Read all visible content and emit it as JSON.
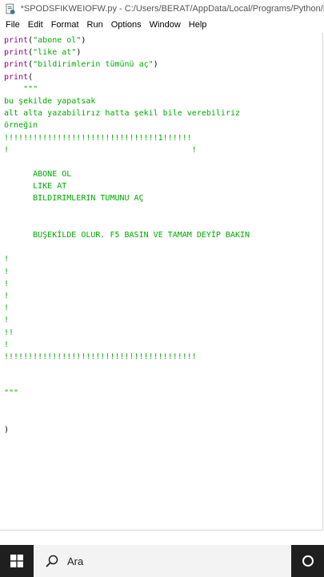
{
  "window": {
    "title": "*SPODSFIKWEIOFW.py - C:/Users/BERAT/AppData/Local/Programs/Python/Py"
  },
  "menu": {
    "items": [
      "File",
      "Edit",
      "Format",
      "Run",
      "Options",
      "Window",
      "Help"
    ]
  },
  "editor": {
    "lines": [
      [
        {
          "t": "print",
          "c": "kw"
        },
        {
          "t": "(",
          "c": ""
        },
        {
          "t": "\"abone ol\"",
          "c": "str"
        },
        {
          "t": ")",
          "c": ""
        }
      ],
      [
        {
          "t": "print",
          "c": "kw"
        },
        {
          "t": "(",
          "c": ""
        },
        {
          "t": "\"like at\"",
          "c": "str"
        },
        {
          "t": ")",
          "c": ""
        }
      ],
      [
        {
          "t": "print",
          "c": "kw"
        },
        {
          "t": "(",
          "c": ""
        },
        {
          "t": "\"bildirimlerin tümünü aç\"",
          "c": "str"
        },
        {
          "t": ")",
          "c": ""
        }
      ],
      [
        {
          "t": "print",
          "c": "kw"
        },
        {
          "t": "(",
          "c": ""
        }
      ],
      [
        {
          "t": "    \"\"\"",
          "c": "str"
        }
      ],
      [
        {
          "t": "bu şekilde yapatsak",
          "c": "str"
        }
      ],
      [
        {
          "t": "alt alta yazabilirız hatta şekil bile verebiliriz",
          "c": "str"
        }
      ],
      [
        {
          "t": "örneğin",
          "c": "str"
        }
      ],
      [
        {
          "t": "!!!!!!!!!!!!!!!!!!!!!!!!!!!!!!!!1!!!!!!",
          "c": "str"
        }
      ],
      [
        {
          "t": "!                                      !",
          "c": "str"
        }
      ],
      [
        {
          "t": "",
          "c": ""
        }
      ],
      [
        {
          "t": "      ABONE OL",
          "c": "str"
        }
      ],
      [
        {
          "t": "      LIKE AT",
          "c": "str"
        }
      ],
      [
        {
          "t": "      BILDIRIMLERIN TUMUNU AÇ",
          "c": "str"
        }
      ],
      [
        {
          "t": "",
          "c": ""
        }
      ],
      [
        {
          "t": "",
          "c": ""
        }
      ],
      [
        {
          "t": "      BUŞEKİLDE OLUR. F5 BASIN VE TAMAM DEYİP BAKIN",
          "c": "str"
        }
      ],
      [
        {
          "t": "",
          "c": ""
        }
      ],
      [
        {
          "t": "!",
          "c": "str"
        }
      ],
      [
        {
          "t": "!",
          "c": "str"
        }
      ],
      [
        {
          "t": "!",
          "c": "str"
        }
      ],
      [
        {
          "t": "!",
          "c": "str"
        }
      ],
      [
        {
          "t": "!",
          "c": "str"
        }
      ],
      [
        {
          "t": "!",
          "c": "str"
        }
      ],
      [
        {
          "t": "!!",
          "c": "str"
        }
      ],
      [
        {
          "t": "!",
          "c": "str"
        }
      ],
      [
        {
          "t": "!!!!!!!!!!!!!!!!!!!!!!!!!!!!!!!!!!!!!!!!",
          "c": "str"
        }
      ],
      [
        {
          "t": "",
          "c": ""
        }
      ],
      [
        {
          "t": "",
          "c": ""
        }
      ],
      [
        {
          "t": "\"\"\"",
          "c": "str"
        }
      ],
      [
        {
          "t": "",
          "c": ""
        }
      ],
      [
        {
          "t": "",
          "c": ""
        }
      ],
      [
        {
          "t": ")",
          "c": ""
        }
      ]
    ]
  },
  "taskbar": {
    "search_placeholder": "Ara",
    "start_icon": "windows-logo-icon",
    "search_icon": "search-icon",
    "cortana_icon": "cortana-ring-icon"
  },
  "colors": {
    "keyword": "#900090",
    "string": "#00aa00",
    "taskbar": "#1f1f1f",
    "search_box": "#f3f3f3"
  }
}
